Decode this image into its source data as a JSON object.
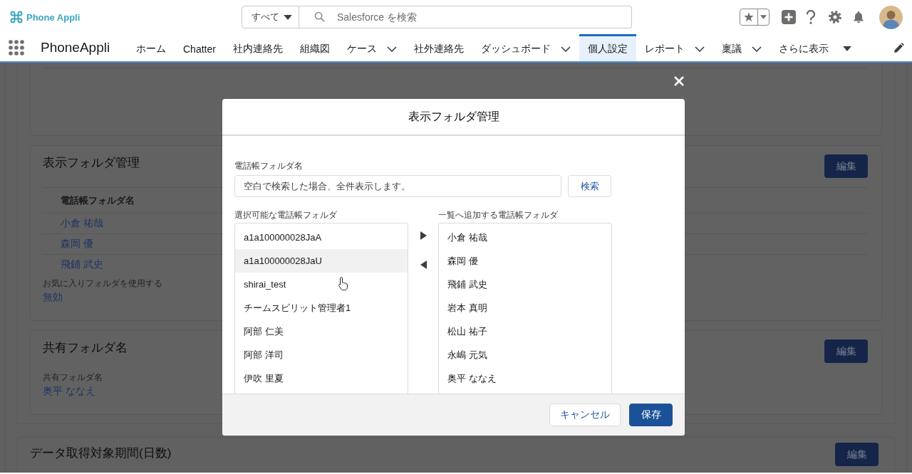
{
  "header": {
    "logo": "Phone Appli",
    "search_scope": "すべて",
    "search": {
      "placeholder": "Salesforce を検索"
    }
  },
  "nav": {
    "app_name": "PhoneAppli",
    "items": [
      {
        "label": "ホーム",
        "kind": "link",
        "selected": false
      },
      {
        "label": "Chatter",
        "kind": "link",
        "selected": false
      },
      {
        "label": "社内連絡先",
        "kind": "link",
        "selected": false
      },
      {
        "label": "組織図",
        "kind": "link",
        "selected": false
      },
      {
        "label": "ケース",
        "kind": "menu",
        "selected": false
      },
      {
        "label": "社外連絡先",
        "kind": "link",
        "selected": false
      },
      {
        "label": "ダッシュボード",
        "kind": "menu",
        "selected": false
      },
      {
        "label": "個人設定",
        "kind": "link",
        "selected": true
      },
      {
        "label": "レポート",
        "kind": "menu",
        "selected": false
      },
      {
        "label": "稟議",
        "kind": "menu",
        "selected": false
      },
      {
        "label": "さらに表示",
        "kind": "more",
        "selected": false
      }
    ]
  },
  "page": {
    "cards": [
      {
        "title": "表示フォルダ管理",
        "edit_button": "編集",
        "table": {
          "columns": [
            "電話帳フォルダ名"
          ],
          "rows": [
            [
              "小倉 祐哉"
            ],
            [
              "森岡 優"
            ],
            [
              "飛鋪 武史"
            ]
          ]
        },
        "fields": [
          {
            "label": "お気に入りフォルダを使用する",
            "value": "無効"
          }
        ]
      },
      {
        "title": "共有フォルダ名",
        "edit_button": "編集",
        "fields": [
          {
            "label": "共有フォルダ名",
            "value": "奥平 ななえ"
          }
        ]
      }
    ],
    "period_card": {
      "title": "データ取得対象期間(日数)",
      "edit_button": "編集"
    }
  },
  "modal": {
    "title": "表示フォルダ管理",
    "search_label": "電話帳フォルダ名",
    "search_field": {
      "placeholder": "空白で検索した場合、全件表示します。"
    },
    "search_button": "検索",
    "available": {
      "label": "選択可能な電話帳フォルダ",
      "items": [
        {
          "label": "a1a100000028JaA",
          "selected": false
        },
        {
          "label": "a1a100000028JaU",
          "selected": true
        },
        {
          "label": "shirai_test",
          "selected": false
        },
        {
          "label": "チームスピリット管理者1",
          "selected": false
        },
        {
          "label": "阿部 仁美",
          "selected": false
        },
        {
          "label": "阿部 洋司",
          "selected": false
        },
        {
          "label": "伊吹 里夏",
          "selected": false
        }
      ]
    },
    "chosen": {
      "label": "一覧へ追加する電話帳フォルダ",
      "items": [
        {
          "label": "小倉 祐哉",
          "selected": false
        },
        {
          "label": "森岡 優",
          "selected": false
        },
        {
          "label": "飛鋪 武史",
          "selected": false
        },
        {
          "label": "岩本 真明",
          "selected": false
        },
        {
          "label": "松山 祐子",
          "selected": false
        },
        {
          "label": "永嶋 元気",
          "selected": false
        },
        {
          "label": "奥平 ななえ",
          "selected": false
        }
      ]
    },
    "buttons": [
      {
        "label": "キャンセル",
        "kind": "neutral"
      },
      {
        "label": "保存",
        "kind": "brand"
      }
    ]
  }
}
